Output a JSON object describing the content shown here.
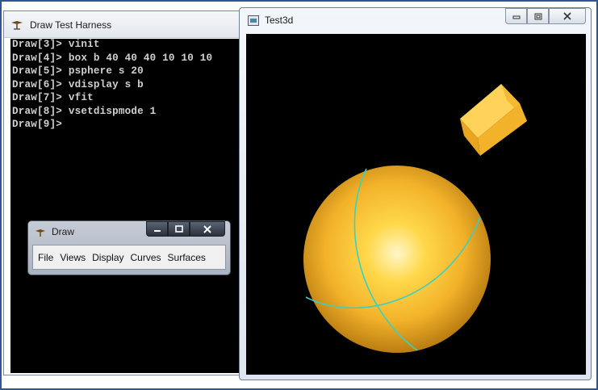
{
  "console_window": {
    "title": "Draw Test Harness",
    "lines": [
      "Draw[3]> vinit",
      "Draw[4]> box b 40 40 40 10 10 10",
      "Draw[5]> psphere s 20",
      "Draw[6]> vdisplay s b",
      "Draw[7]> vfit",
      "Draw[8]> vsetdispmode 1",
      "Draw[9]>"
    ]
  },
  "draw_window": {
    "title": "Draw",
    "menu": [
      "File",
      "Views",
      "Display",
      "Curves",
      "Surfaces"
    ]
  },
  "viewer_window": {
    "title": "Test3d",
    "objects": [
      "sphere",
      "box"
    ]
  },
  "colors": {
    "shape_gold": "#f2b22a",
    "edge_cyan": "#3ad0c2",
    "viewport_bg": "#000000",
    "frame_blue": "#2f5597"
  }
}
